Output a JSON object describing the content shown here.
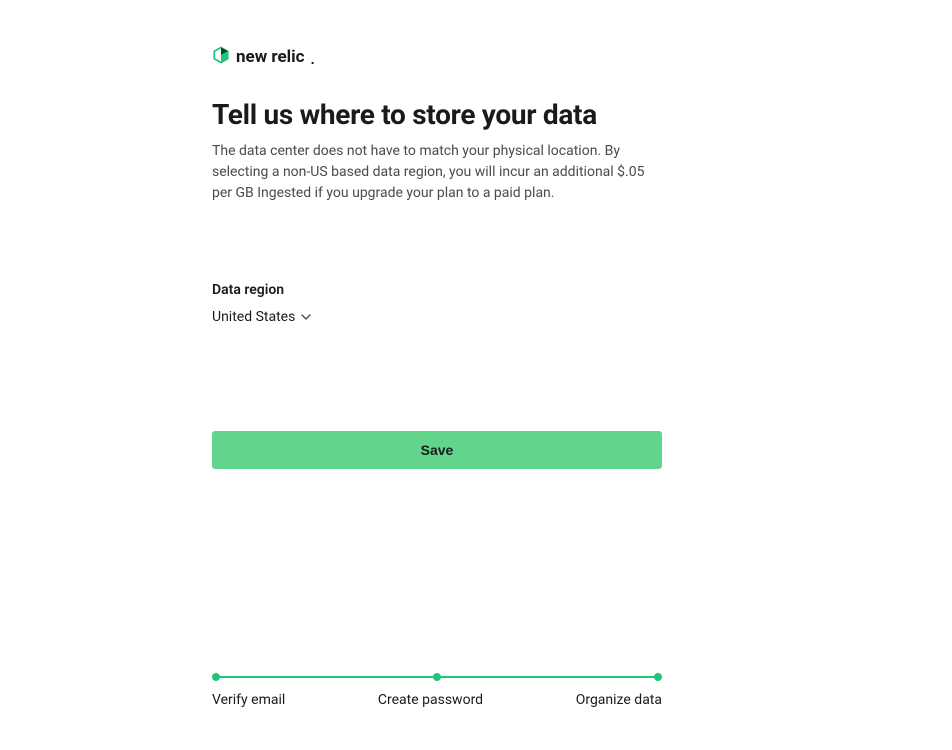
{
  "logo": {
    "text": "new relic"
  },
  "page": {
    "heading": "Tell us where to store your data",
    "subtext": "The data center does not have to match your physical location. By selecting a non-US based data region, you will incur an additional $.05 per GB Ingested if you upgrade your plan to a paid plan."
  },
  "form": {
    "region_label": "Data region",
    "region_value": "United States",
    "save_label": "Save"
  },
  "stepper": {
    "steps": [
      {
        "label": "Verify email"
      },
      {
        "label": "Create password"
      },
      {
        "label": "Organize data"
      }
    ]
  }
}
